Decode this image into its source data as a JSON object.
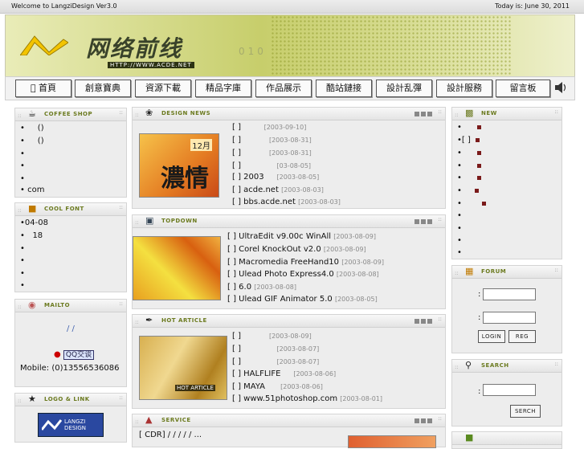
{
  "topbar": {
    "welcome": "Welcome to LangziDesign Ver3.0",
    "today": "Today is: June 30, 2011"
  },
  "banner": {
    "title": "网络前线",
    "url": "HTTP://WWW.ACDE.NET",
    "faint_text": "010"
  },
  "nav": {
    "items": [
      {
        "label": "首頁"
      },
      {
        "label": "創意寶典"
      },
      {
        "label": "資源下載"
      },
      {
        "label": "精品字庫"
      },
      {
        "label": "作品展示"
      },
      {
        "label": "酷站鏈接"
      },
      {
        "label": "設計乱彈"
      },
      {
        "label": "設計服務"
      },
      {
        "label": "留言板"
      }
    ]
  },
  "coffee_shop": {
    "title": "COFFEE SHOP",
    "items": [
      "()",
      "()",
      "",
      "",
      "",
      "com"
    ]
  },
  "cool_font": {
    "title": "COOL FONT",
    "items": [
      "04-08",
      "18",
      "",
      "",
      "",
      ""
    ]
  },
  "mailto": {
    "title": "MAILTO",
    "slashes": "/ /",
    "qq": "QQ交谈",
    "mobile": "Mobile: (0)13556536086"
  },
  "logo_link": {
    "title": "LOGO & LINK",
    "logo_text": "LANGZI DESIGN"
  },
  "design_news": {
    "title": "DESIGN NEWS",
    "thumb_month": "12月",
    "thumb_text": "濃情",
    "items": [
      {
        "text": "[ ]",
        "date": "[2003-09-10]"
      },
      {
        "text": "[ ]",
        "date": "[2003-08-31]"
      },
      {
        "text": "[ ]",
        "date": "[2003-08-31]"
      },
      {
        "text": "[ ]",
        "date": "[03-08-05]"
      },
      {
        "text": "[ ]  2003",
        "date": "[2003-08-05]"
      },
      {
        "text": "[ ]       acde.net",
        "date": "[2003-08-03]"
      },
      {
        "text": "[ ]    bbs.acde.net",
        "date": "[2003-08-03]"
      }
    ]
  },
  "topdown": {
    "title": "TOPDOWN",
    "items": [
      {
        "text": "[ ] UltraEdit v9.00c WinAll",
        "date": "[2003-08-09]"
      },
      {
        "text": "[ ] Corel KnockOut v2.0",
        "date": "[2003-08-09]"
      },
      {
        "text": "[ ] Macromedia FreeHand10",
        "date": "[2003-08-09]"
      },
      {
        "text": "[ ] Ulead Photo Express4.0",
        "date": "[2003-08-08]"
      },
      {
        "text": "[ ]          6.0",
        "date": "[2003-08-08]"
      },
      {
        "text": "[ ] Ulead GIF Animator 5.0",
        "date": "[2003-08-05]"
      }
    ]
  },
  "hot_article": {
    "title": "HOT ARTICLE",
    "thumb_label": "HOT ARTICLE",
    "items": [
      {
        "text": "[ ]",
        "date": "[2003-08-09]"
      },
      {
        "text": "[ ]",
        "date": "[2003-08-07]"
      },
      {
        "text": "[ ]",
        "date": "[2003-08-07]"
      },
      {
        "text": "[ ] HALFLIFE",
        "date": "[2003-08-06]"
      },
      {
        "text": "[ ] MAYA",
        "date": "[2003-08-06]"
      },
      {
        "text": "[ ] www.51photoshop.com",
        "date": "[2003-08-01]"
      }
    ]
  },
  "service": {
    "title": "SERVICE",
    "line": "[ CDR] / / / / / ..."
  },
  "new_panel": {
    "title": "NEW",
    "bracket": "[ ]"
  },
  "forum": {
    "title": "FORUM",
    "colon": ":",
    "login": "LOGIN",
    "reg": "REG"
  },
  "search": {
    "title": "SEARCH",
    "colon": ":",
    "button": "SERCH"
  },
  "colors": {
    "accent": "#6b7a1f",
    "panel_bg": "#ededed",
    "banner": "#c7ce6b",
    "marker": "#7a1a1a"
  }
}
